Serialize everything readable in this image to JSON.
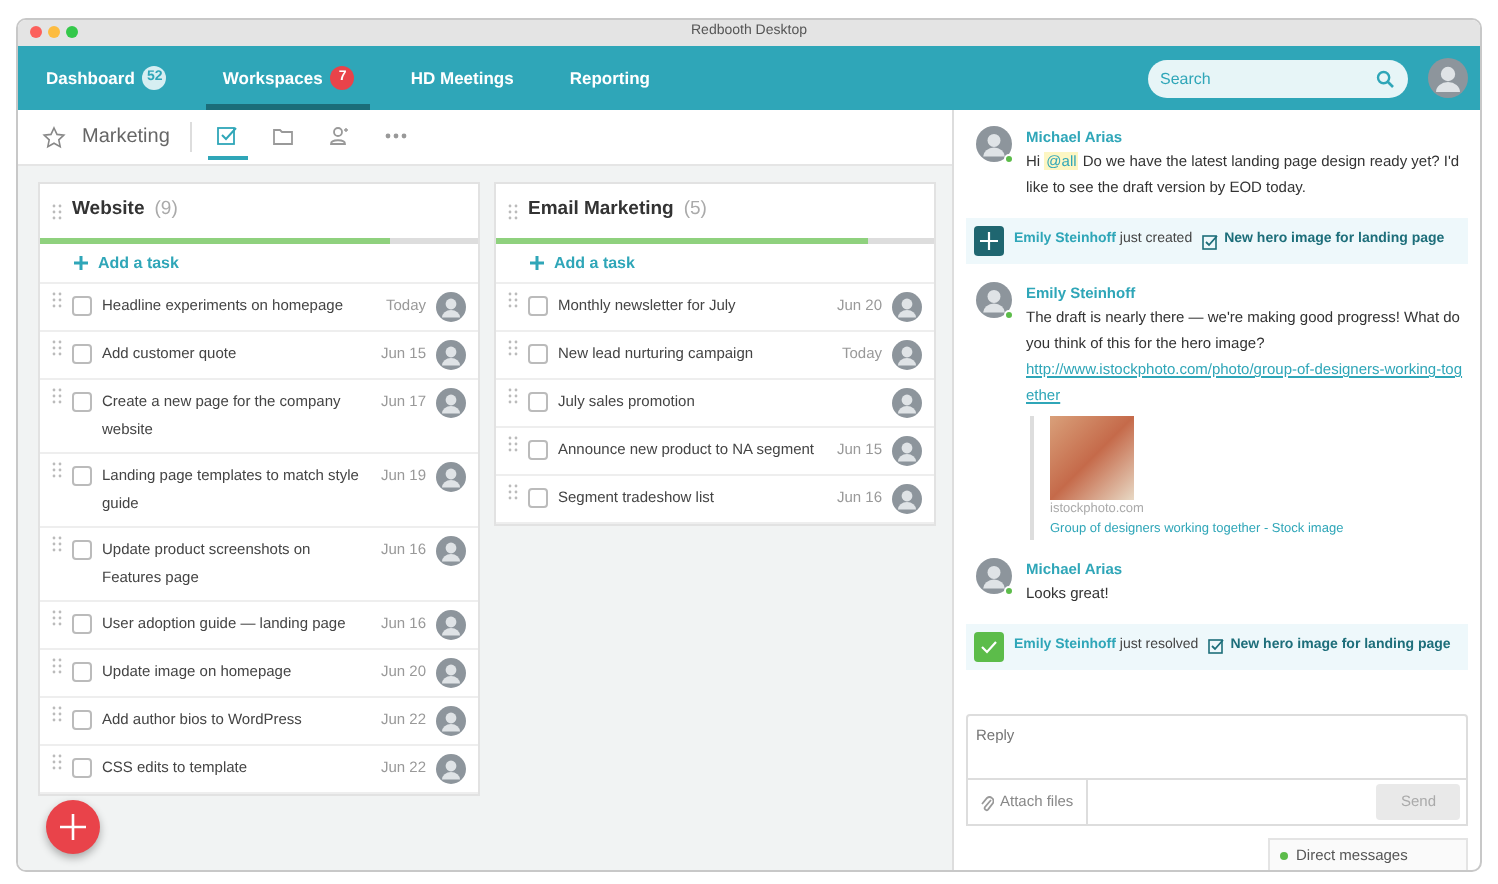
{
  "window": {
    "title": "Redbooth Desktop"
  },
  "nav": {
    "tabs": [
      {
        "label": "Dashboard",
        "count": "52",
        "kind": "muted",
        "selected": false
      },
      {
        "label": "Workspaces",
        "count": "7",
        "kind": "alert",
        "selected": true
      },
      {
        "label": "HD Meetings",
        "selected": false
      },
      {
        "label": "Reporting",
        "selected": false
      }
    ],
    "search": {
      "placeholder": "Search"
    }
  },
  "workspace": {
    "title": "Marketing",
    "favorite": false,
    "views": [
      {
        "kind": "checkbox",
        "selected": true
      },
      {
        "kind": "folder",
        "selected": false
      },
      {
        "kind": "people",
        "selected": false
      },
      {
        "kind": "more",
        "selected": false
      }
    ]
  },
  "task_lists": [
    {
      "title": "Website",
      "count": "(9)",
      "level": 0.8,
      "add_label": "Add a task",
      "tasks": [
        {
          "text": "Headline experiments on homepage",
          "date": "Today",
          "checked": false
        },
        {
          "text": "Add customer quote",
          "date": "Jun 15",
          "checked": false
        },
        {
          "text": "Create a new page for the company website",
          "date": "Jun 17",
          "checked": false
        },
        {
          "text": "Landing page templates to match style guide",
          "date": "Jun 19",
          "checked": false
        },
        {
          "text": "Update product screenshots on Features page",
          "date": "Jun 16",
          "checked": false
        },
        {
          "text": "User adoption guide — landing page",
          "date": "Jun 16",
          "checked": false
        },
        {
          "text": "Update image on homepage",
          "date": "Jun 20",
          "checked": false
        },
        {
          "text": "Add author bios to WordPress",
          "date": "Jun 22",
          "checked": false
        },
        {
          "text": "CSS edits to template",
          "date": "Jun 22",
          "checked": false
        }
      ]
    },
    {
      "title": "Email Marketing",
      "count": "(5)",
      "level": 0.85,
      "add_label": "Add a task",
      "tasks": [
        {
          "text": "Monthly newsletter for July",
          "date": "Jun 20",
          "checked": false
        },
        {
          "text": "New lead nurturing campaign",
          "date": "Today",
          "checked": false
        },
        {
          "text": "July sales promotion",
          "checked": false
        },
        {
          "text": "Announce new product to NA segment",
          "date": "Jun 15",
          "checked": false
        },
        {
          "text": "Segment tradeshow list",
          "date": "Jun 16",
          "checked": false
        }
      ]
    }
  ],
  "chat": {
    "messages": [
      {
        "kind": "message",
        "author": "Michael Arias",
        "online": true,
        "parts": [
          {
            "kind": "text",
            "text": "Hi"
          },
          {
            "kind": "mention",
            "text": "@all"
          },
          {
            "kind": "text",
            "text": "Do we have the latest landing page design ready yet? I'd like to see the draft version by EOD today."
          }
        ]
      },
      {
        "kind": "created",
        "author": "Emily Steinhoff",
        "action": "just created",
        "task": "New hero image for landing page"
      },
      {
        "kind": "message",
        "author": "Emily Steinhoff",
        "online": true,
        "parts": [
          {
            "kind": "text",
            "text": "The draft is nearly there — we're making good progress! What do you think of this for the hero image?"
          },
          {
            "kind": "link",
            "text": "http://www.istockphoto.com/photo/group-of-designers-working-together"
          }
        ],
        "preview": {
          "source": "istockphoto.com",
          "title": "Group of designers working together - Stock image"
        }
      },
      {
        "kind": "message",
        "author": "Michael Arias",
        "online": true,
        "parts": [
          {
            "kind": "text",
            "text": "Looks great!"
          }
        ]
      },
      {
        "kind": "resolved",
        "author": "Emily Steinhoff",
        "action": "just resolved",
        "task": "New hero image for landing page"
      }
    ],
    "reply": {
      "placeholder": "Reply",
      "attach": "Attach files",
      "send": "Send",
      "send_disabled": true
    },
    "direct_messages": {
      "label": "Direct messages",
      "online": true
    }
  }
}
